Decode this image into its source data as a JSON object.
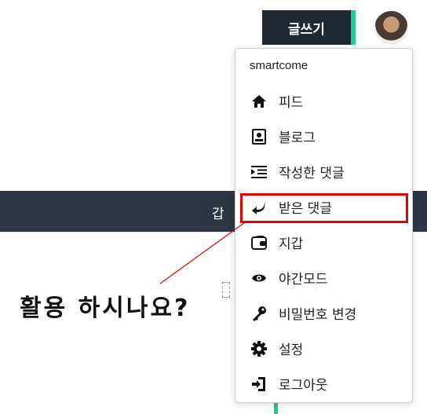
{
  "header": {
    "write_label": "글쓰기"
  },
  "background": {
    "band_text": "갑"
  },
  "menu": {
    "username": "smartcome",
    "items": [
      {
        "label": "피드",
        "icon": "home-icon"
      },
      {
        "label": "블로그",
        "icon": "contact-card-icon"
      },
      {
        "label": "작성한 댓글",
        "icon": "list-indent-icon"
      },
      {
        "label": "받은 댓글",
        "icon": "reply-arrow-icon"
      },
      {
        "label": "지갑",
        "icon": "wallet-icon"
      },
      {
        "label": "야간모드",
        "icon": "eye-icon"
      },
      {
        "label": "비밀번호 변경",
        "icon": "key-icon"
      },
      {
        "label": "설정",
        "icon": "gear-icon"
      },
      {
        "label": "로그아웃",
        "icon": "logout-icon"
      }
    ]
  },
  "annotation": {
    "text": "활용 하시나요?",
    "color": "#e60000"
  },
  "colors": {
    "accent": "#20c997",
    "dark": "#1f2933",
    "highlight": "#e60000"
  }
}
